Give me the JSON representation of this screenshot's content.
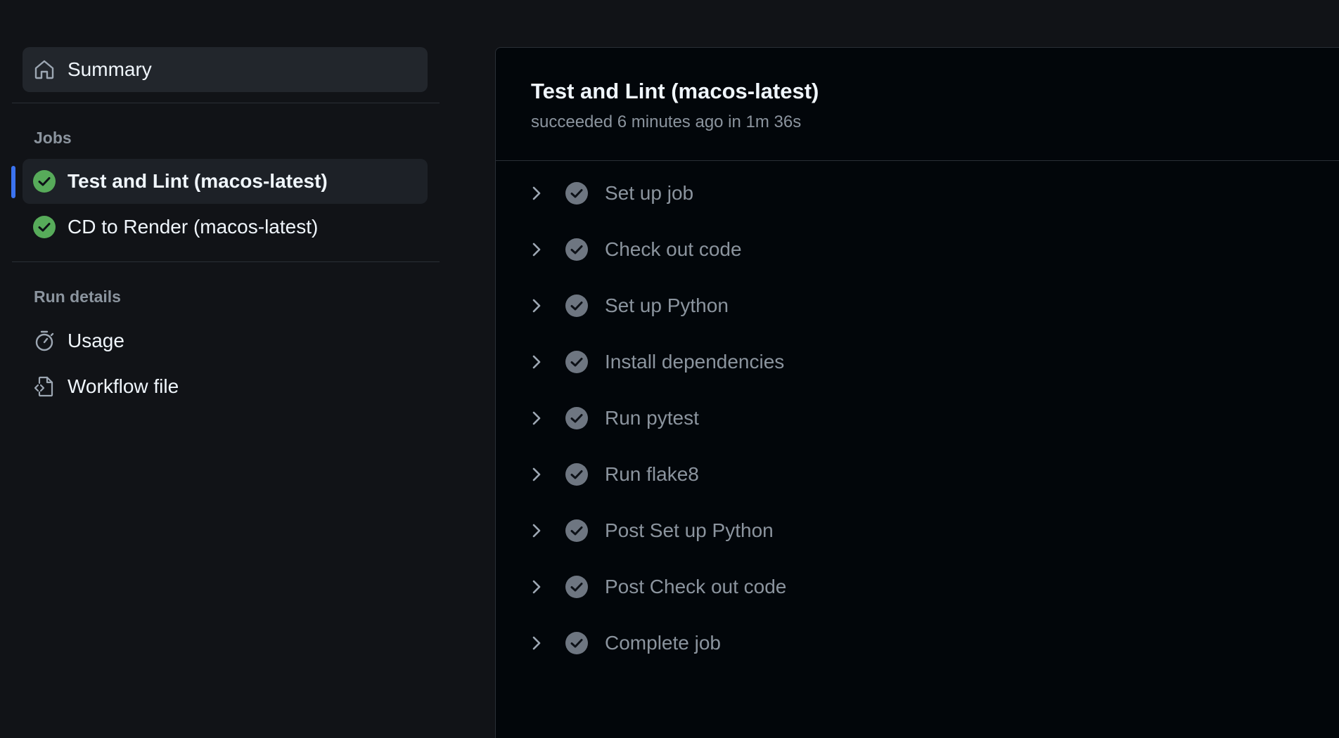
{
  "sidebar": {
    "summary_label": "Summary",
    "jobs_heading": "Jobs",
    "jobs": [
      {
        "label": "Test and Lint (macos-latest)",
        "status": "success",
        "active": true
      },
      {
        "label": "CD to Render (macos-latest)",
        "status": "success",
        "active": false
      }
    ],
    "run_details_heading": "Run details",
    "usage_label": "Usage",
    "workflow_label": "Workflow file"
  },
  "main": {
    "title": "Test and Lint (macos-latest)",
    "subtitle": "succeeded 6 minutes ago in 1m 36s",
    "steps": [
      "Set up job",
      "Check out code",
      "Set up Python",
      "Install dependencies",
      "Run pytest",
      "Run flake8",
      "Post Set up Python",
      "Post Check out code",
      "Complete job"
    ]
  },
  "colors": {
    "success": "#57ab5a",
    "accent": "#3b73f0",
    "step_check": "#6e7681"
  }
}
